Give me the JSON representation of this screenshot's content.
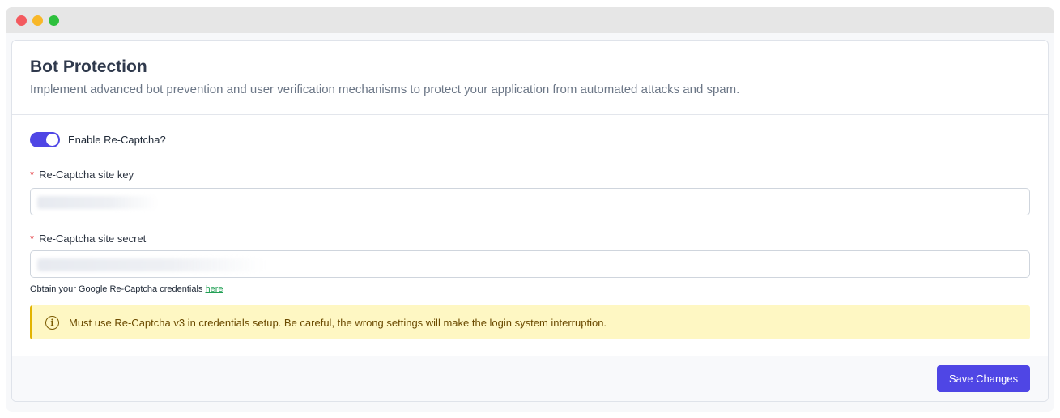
{
  "window": {
    "controls": [
      "close",
      "minimize",
      "maximize"
    ]
  },
  "header": {
    "title": "Bot Protection",
    "description": "Implement advanced bot prevention and user verification mechanisms to protect your application from automated attacks and spam."
  },
  "form": {
    "toggle": {
      "label": "Enable Re-Captcha?",
      "enabled": true
    },
    "site_key": {
      "required_mark": "*",
      "label": "Re-Captcha site key",
      "value": ""
    },
    "site_secret": {
      "required_mark": "*",
      "label": "Re-Captcha site secret",
      "value": ""
    },
    "help": {
      "text": "Obtain your Google Re-Captcha credentials ",
      "link_text": "here"
    },
    "alert": {
      "icon": "info-icon",
      "icon_glyph": "i",
      "text": "Must use Re-Captcha v3 in credentials setup. Be careful, the wrong settings will make the login system interruption."
    }
  },
  "footer": {
    "save_label": "Save Changes"
  },
  "colors": {
    "accent": "#4f46e5",
    "alert_bg": "#fef7c3",
    "alert_border": "#e2b300",
    "link": "#22a055",
    "required": "#e5484d"
  }
}
